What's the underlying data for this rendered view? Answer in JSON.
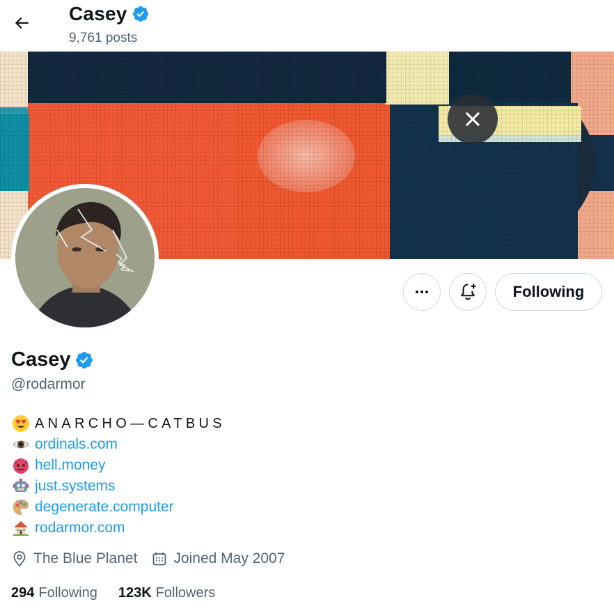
{
  "header": {
    "name": "Casey",
    "posts_count": "9,761 posts"
  },
  "profile": {
    "name": "Casey",
    "handle": "@rodarmor",
    "following_button_label": "Following"
  },
  "bio": {
    "tagline": "ANARCHO—CATBUS",
    "links": [
      {
        "emoji": "eye-emoji",
        "text": "ordinals.com"
      },
      {
        "emoji": "devil-emoji",
        "text": "hell.money"
      },
      {
        "emoji": "robot-emoji",
        "text": "just.systems"
      },
      {
        "emoji": "palette-emoji",
        "text": "degenerate.computer"
      },
      {
        "emoji": "house-emoji",
        "text": "rodarmor.com"
      }
    ]
  },
  "meta": {
    "location": "The Blue Planet",
    "joined": "Joined May 2007"
  },
  "stats": {
    "following_count": "294",
    "following_label": "Following",
    "followers_count": "123K",
    "followers_label": "Followers"
  },
  "colors": {
    "link": "#1d9bf0",
    "verified": "#1d9bf0",
    "secondary_text": "#536471"
  }
}
